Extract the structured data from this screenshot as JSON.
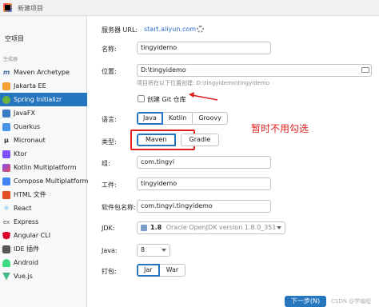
{
  "window": {
    "title": "新建项目"
  },
  "sidebar": {
    "empty_project": "空项目",
    "generators_header": "生成器",
    "items": [
      {
        "label": "Maven Archetype",
        "icon": "maven-icon"
      },
      {
        "label": "Jakarta EE",
        "icon": "jakarta-icon"
      },
      {
        "label": "Spring Initializr",
        "icon": "spring-icon",
        "selected": true
      },
      {
        "label": "JavaFX",
        "icon": "javafx-icon"
      },
      {
        "label": "Quarkus",
        "icon": "quarkus-icon"
      },
      {
        "label": "Micronaut",
        "icon": "micronaut-icon"
      },
      {
        "label": "Ktor",
        "icon": "ktor-icon"
      },
      {
        "label": "Kotlin Multiplatform",
        "icon": "kotlin-multiplatform-icon"
      },
      {
        "label": "Compose Multiplatform",
        "icon": "compose-icon"
      },
      {
        "label": "HTML 文件",
        "icon": "html-icon"
      },
      {
        "label": "React",
        "icon": "react-icon"
      },
      {
        "label": "Express",
        "icon": "express-icon"
      },
      {
        "label": "Angular CLI",
        "icon": "angular-icon"
      },
      {
        "label": "IDE 插件",
        "icon": "ide-plugin-icon"
      },
      {
        "label": "Android",
        "icon": "android-icon"
      },
      {
        "label": "Vue.js",
        "icon": "vue-icon"
      }
    ]
  },
  "form": {
    "server_url_label": "服务器 URL:",
    "server_url_value": "start.aliyun.com",
    "name_label": "名称:",
    "name_value": "tingyidemo",
    "location_label": "位置:",
    "location_value": "D:\\tingyidemo",
    "location_hint": "项目将在以下位置创建: D:\\tingyidemo\\tingyidemo",
    "git_label": "创建 Git 仓库",
    "language_label": "语言:",
    "languages": [
      "Java",
      "Kotlin",
      "Groovy"
    ],
    "type_label": "类型:",
    "types": [
      "Maven",
      "Gradle"
    ],
    "group_label": "组:",
    "group_value": "com.tingyi",
    "artifact_label": "工件:",
    "artifact_value": "tingyidemo",
    "package_label": "软件包名称:",
    "package_value": "com.tingyi.tingyidemo",
    "jdk_label": "JDK:",
    "jdk_version": "1.8",
    "jdk_name": "Oracle OpenJDK version 1.8.0_351",
    "java_label": "Java:",
    "java_value": "8",
    "packaging_label": "打包:",
    "packaging": [
      "Jar",
      "War"
    ]
  },
  "annotation": {
    "text": "暂时不用勾选",
    "color": "#e02020"
  },
  "footer": {
    "next_label": "下一步(N)",
    "watermark": "CSDN @学编程"
  },
  "colors": {
    "accent": "#2675bf",
    "link": "#2d6ad3",
    "annotation": "#e02020"
  }
}
